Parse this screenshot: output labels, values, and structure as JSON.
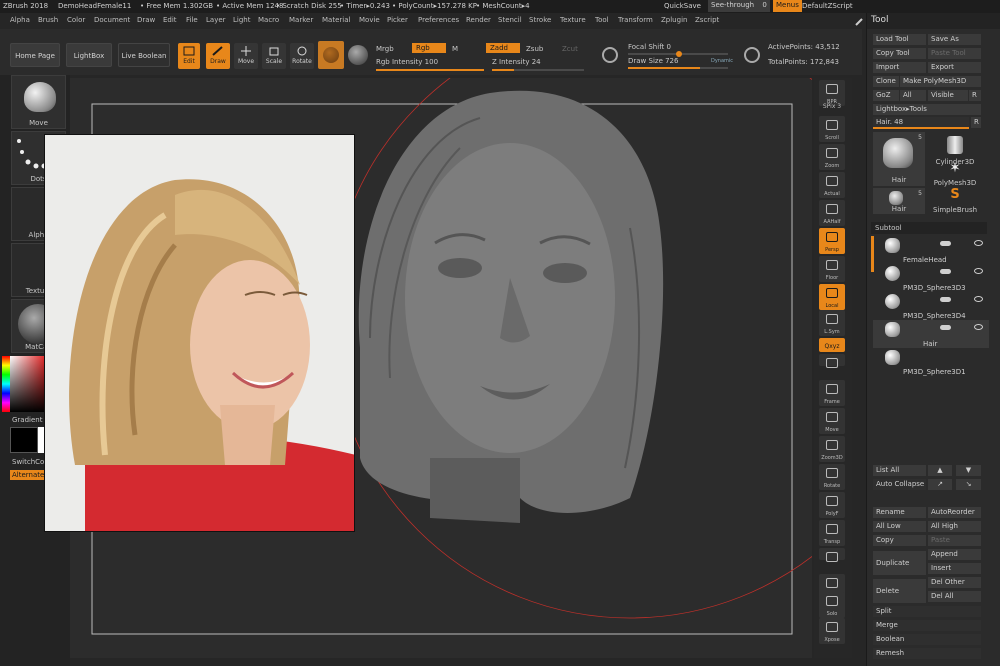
{
  "titlebar": {
    "app": "ZBrush 2018",
    "doc": "DemoHeadFemale11",
    "free_mem": "• Free Mem 1.302GB",
    "active_mem": "• Active Mem 1248",
    "scratch": "• Scratch Disk 255",
    "timer": "• Timer▸0.243",
    "polycount": "• PolyCount▸157.278 KP",
    "meshcount": "• MeshCount▸4",
    "quicksave": "QuickSave",
    "seethrough": "See-through",
    "seethrough_val": "0",
    "menus": "Menus",
    "script": "DefaultZScript"
  },
  "menu": [
    "Alpha",
    "Brush",
    "Color",
    "Document",
    "Draw",
    "Edit",
    "File",
    "Layer",
    "Light",
    "Macro",
    "Marker",
    "Material",
    "Movie",
    "Picker",
    "Preferences",
    "Render",
    "Stencil",
    "Stroke",
    "Texture",
    "Tool",
    "Transform",
    "Zplugin",
    "Zscript"
  ],
  "toolbar": {
    "home": "Home Page",
    "lightbox": "LightBox",
    "liveboolean": "Live Boolean",
    "edit": "Edit",
    "draw": "Draw",
    "move": "Move",
    "scale": "Scale",
    "rotate": "Rotate",
    "mrgb": "Mrgb",
    "rgb": "Rgb",
    "m": "M",
    "zadd": "Zadd",
    "zsub": "Zsub",
    "zcut": "Zcut",
    "rgb_intensity": "Rgb Intensity 100",
    "z_intensity": "Z Intensity 24",
    "focal_shift": "Focal Shift 0",
    "draw_size": "Draw Size 726",
    "dynamic": "Dynamic",
    "active_points": "ActivePoints: 43,512",
    "total_points": "TotalPoints: 172,843"
  },
  "leftshelf": {
    "move": "Move",
    "dots": "Dots",
    "alpha": "Alpha",
    "texture": "Texture",
    "matcap": "MatCap",
    "gradient": "Gradient",
    "switchcolor": "SwitchCol",
    "alternate": "Alternate"
  },
  "rightshelf": [
    "BPR",
    "SPix 3",
    "Scroll",
    "Zoom",
    "Actual",
    "AAHalf",
    "Persp",
    "Floor",
    "Local",
    "L.Sym",
    "Qxyz",
    "",
    "Frame",
    "Move",
    "Zoom3D",
    "Rotate",
    "PolyF",
    "Transp",
    "",
    "Dynamic",
    "Solo",
    "Xpose"
  ],
  "rightshelf_extra": {
    "spix": "SPix 3",
    "linefill": "Line Fill"
  },
  "tool": {
    "title": "Tool",
    "load": "Load Tool",
    "saveas": "Save As",
    "copy": "Copy Tool",
    "paste": "Paste Tool",
    "import": "Import",
    "export": "Export",
    "clone": "Clone",
    "makepoly": "Make PolyMesh3D",
    "goz": "GoZ",
    "all": "All",
    "visible": "Visible",
    "r": "R",
    "lightboxtools": "Lightbox▸Tools",
    "hair_slider": "Hair. 48",
    "thumbs": [
      "Hair",
      "Cylinder3D",
      "PolyMesh3D",
      "Hair",
      "SimpleBrush"
    ],
    "thumb_count1": "5",
    "thumb_count2": "5",
    "subtool": "Subtool",
    "subtools": [
      "FemaleHead",
      "PM3D_Sphere3D3",
      "PM3D_Sphere3D4",
      "Hair",
      "PM3D_Sphere3D1"
    ],
    "listall": "List All",
    "autocollapse": "Auto Collapse",
    "rename": "Rename",
    "autoreorder": "AutoReorder",
    "alllow": "All Low",
    "allhigh": "All High",
    "copy2": "Copy",
    "paste2": "Paste",
    "duplicate": "Duplicate",
    "append": "Append",
    "insert": "Insert",
    "delete": "Delete",
    "delother": "Del Other",
    "delall": "Del All",
    "split": "Split",
    "merge": "Merge",
    "boolean": "Boolean",
    "remesh": "Remesh"
  },
  "colors": {
    "accent": "#e8871a",
    "bg": "#262626",
    "panel": "#2b2b2b"
  }
}
